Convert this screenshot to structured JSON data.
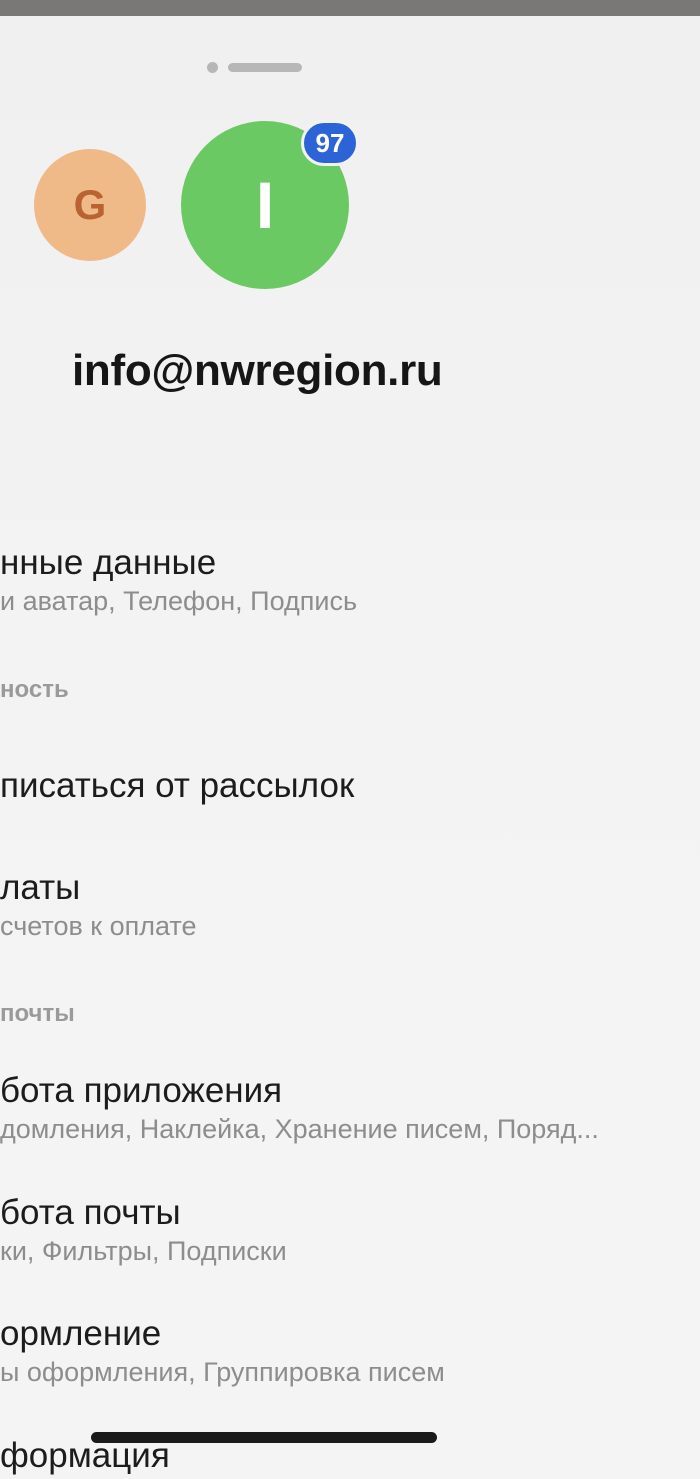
{
  "account": {
    "avatars": [
      {
        "letter": "G",
        "color": "#f0b988"
      },
      {
        "letter": "I",
        "color": "#6bc964"
      }
    ],
    "badge_count": "97",
    "email": "info@nwregion.ru"
  },
  "menu": {
    "personal_title": "нные данные",
    "personal_sub": " и аватар, Телефон, Подпись",
    "section_security": "ность",
    "unsubscribe_title": "писаться от рассылок",
    "payments_title": "латы",
    "payments_sub": " счетов к оплате",
    "section_mail": "почты",
    "app_title": "бота приложения",
    "app_sub": "домления, Наклейка, Хранение писем, Поряд...",
    "mail_title": "бота почты",
    "mail_sub": "ки, Фильтры, Подписки",
    "design_title": "ормление",
    "design_sub": "ы оформления, Группировка писем",
    "info_title": "формация"
  }
}
